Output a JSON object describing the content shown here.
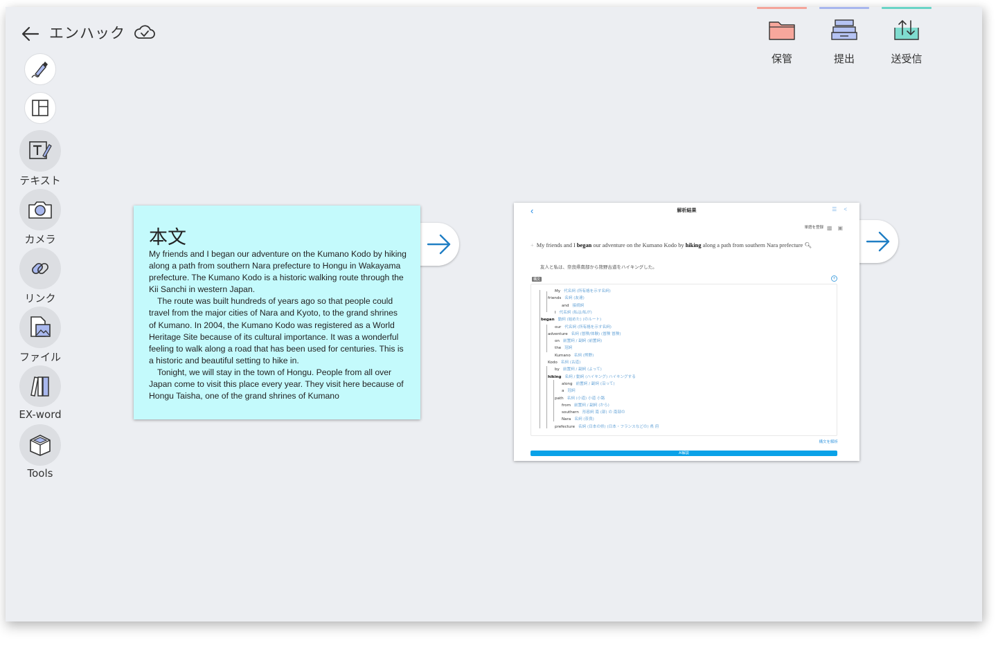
{
  "header": {
    "title": "エンハック",
    "back_icon": "arrow-left-icon",
    "cloud_icon": "cloud-check-icon"
  },
  "top_toolbar": [
    {
      "label": "保管",
      "icon": "folder-icon",
      "accent": "#f4a49a"
    },
    {
      "label": "提出",
      "icon": "tray-stack-icon",
      "accent": "#a7b6ee"
    },
    {
      "label": "送受信",
      "icon": "upload-download-icon",
      "accent": "#69d4c6"
    }
  ],
  "tools": [
    {
      "label": "",
      "icon": "pen-icon"
    },
    {
      "label": "",
      "icon": "layout-icon"
    },
    {
      "label": "テキスト",
      "icon": "text-edit-icon"
    },
    {
      "label": "カメラ",
      "icon": "camera-icon"
    },
    {
      "label": "リンク",
      "icon": "link-icon"
    },
    {
      "label": "ファイル",
      "icon": "file-image-icon"
    },
    {
      "label": "EX-word",
      "icon": "books-icon"
    },
    {
      "label": "Tools",
      "icon": "toolbox-icon"
    }
  ],
  "text_card": {
    "title": "本文",
    "paragraphs": [
      "My friends and I began our adventure on the Kumano Kodo by hiking along a path from southern Nara prefecture to Hongu in Wakayama prefecture. The Kumano Kodo is a historic walking route through the Kii Sanchi in western Japan.",
      "The route was built hundreds of years ago so that people could travel from the major cities of Nara and Kyoto, to the grand shrines of Kumano. In 2004, the Kumano Kodo was registered as a World Heritage Site because of its cultural importance. It was a wonderful feeling to walk along a road that has been used for centuries. This is a historic and beautiful setting to hike in.",
      "Tonight, we will stay in the town of Hongu. People from all over Japan come to visit this place every year. They visit here because of Hongu Taisha, one of the grand shrines of Kumano"
    ],
    "bg": "#c4fafc"
  },
  "result_card": {
    "title": "解析結果",
    "add_word": "単語を登録",
    "sentence_parts": [
      {
        "t": "My friends and I ",
        "b": false
      },
      {
        "t": "began",
        "b": true
      },
      {
        "t": " our adventure on the Kumano Kodo by ",
        "b": false
      },
      {
        "t": "hiking",
        "b": true
      },
      {
        "t": " along a path from southern Nara prefecture",
        "b": false
      }
    ],
    "translation": "友人と私は、奈良県南部から熊野古道をハイキングした。",
    "tag": "構文",
    "tree": [
      {
        "w": "My",
        "g": "代名詞 (所有格を示す名詞)",
        "d": 1,
        "b": false
      },
      {
        "w": "friends",
        "g": "名詞 (友達)",
        "d": 0,
        "b": false
      },
      {
        "w": "and",
        "g": "接続詞",
        "d": 2,
        "b": false
      },
      {
        "w": "I",
        "g": "代名詞 (私は/私が)",
        "d": 1,
        "b": false
      },
      {
        "w": "began",
        "g": "動詞 (始めた)  (のルート)",
        "d": -1,
        "b": true
      },
      {
        "w": "our",
        "g": "代名詞 (所有格を示す名詞)",
        "d": 1,
        "b": false
      },
      {
        "w": "adventure",
        "g": "名詞 (冒険/体験)  (冒険 冒険)",
        "d": 0,
        "b": false
      },
      {
        "w": "on",
        "g": "前置詞 / 副詞 (前置詞)",
        "d": 1,
        "b": false
      },
      {
        "w": "the",
        "g": "冠詞",
        "d": 1,
        "b": false
      },
      {
        "w": "Kumano",
        "g": "名詞 (熊野)",
        "d": 1,
        "b": false
      },
      {
        "w": "Kodo",
        "g": "名詞 (古道)",
        "d": 0,
        "b": false
      },
      {
        "w": "by",
        "g": "前置詞 / 副詞 (よって)",
        "d": 1,
        "b": false
      },
      {
        "w": "hiking",
        "g": "名詞 / 動詞 (ハイキング)  ハイキングする",
        "d": 0,
        "b": true
      },
      {
        "w": "along",
        "g": "前置詞 / 副詞 (沿って)",
        "d": 2,
        "b": false
      },
      {
        "w": "a",
        "g": "冠詞",
        "d": 2,
        "b": false
      },
      {
        "w": "path",
        "g": "名詞 (小道)  小道 小路",
        "d": 1,
        "b": false
      },
      {
        "w": "from",
        "g": "前置詞 / 副詞 (から)",
        "d": 2,
        "b": false
      },
      {
        "w": "southern",
        "g": "形容詞 南 (部) の 南部の",
        "d": 2,
        "b": false
      },
      {
        "w": "Nara",
        "g": "名詞 (奈良)",
        "d": 2,
        "b": false
      },
      {
        "w": "prefecture",
        "g": "名詞 (日本の県)  (日本・フランスなどの) 県 府",
        "d": 1,
        "b": false
      }
    ],
    "link": "構文を解析",
    "bar_label": "AI解説"
  }
}
